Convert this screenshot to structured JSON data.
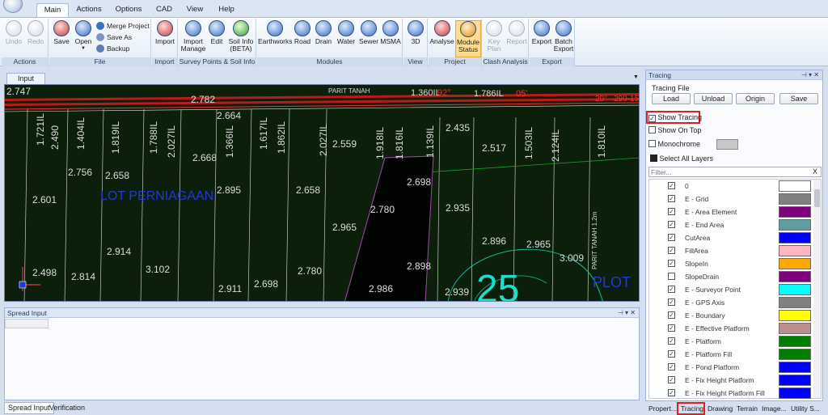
{
  "tabs": [
    "Main",
    "Actions",
    "Options",
    "CAD",
    "View",
    "Help"
  ],
  "ribbon": {
    "actions": {
      "label": "Actions",
      "undo": "Undo",
      "redo": "Redo"
    },
    "file": {
      "label": "File",
      "save": "Save",
      "open": "Open",
      "merge": "Merge Project",
      "save_as": "Save As",
      "backup": "Backup"
    },
    "import": {
      "label": "Import",
      "import": "Import"
    },
    "survey": {
      "label": "Survey Points & Soil Info",
      "import_manage": "Import Manage",
      "edit": "Edit",
      "soil_info": "Soil Info (BETA)"
    },
    "modules": {
      "label": "Modules",
      "items": [
        "Earthworks",
        "Road",
        "Drain",
        "Water",
        "Sewer",
        "MSMA"
      ]
    },
    "view": {
      "label": "View",
      "3d": "3D"
    },
    "project": {
      "label": "Project",
      "analyse": "Analyse",
      "module_status": "Module Status"
    },
    "clash": {
      "label": "Clash Analysis",
      "key_plan": "Key Plan",
      "report": "Report"
    },
    "export": {
      "label": "Export",
      "export": "Export",
      "batch_export": "Batch Export"
    }
  },
  "input_tab": "Input",
  "spread_input": {
    "title": "Spread Input"
  },
  "bottom_tabs": [
    "Spread Input",
    "Verification"
  ],
  "tracing": {
    "title": "Tracing",
    "file_label": "Tracing File",
    "buttons": [
      "Load",
      "Unload",
      "Origin",
      "Save"
    ],
    "show_tracing": "Show Tracing",
    "show_on_top": "Show On Top",
    "monochrome": "Monochrome",
    "select_all": "Select All Layers",
    "filter_placeholder": "Filter...",
    "layers": [
      {
        "name": "0",
        "checked": true,
        "color": "#ffffff"
      },
      {
        "name": "E - Grid",
        "checked": true,
        "color": "#808080"
      },
      {
        "name": "E - Area Element",
        "checked": true,
        "color": "#800080"
      },
      {
        "name": "E - End Area",
        "checked": true,
        "color": "#5f9ea0"
      },
      {
        "name": "CutArea",
        "checked": true,
        "color": "#0000ff"
      },
      {
        "name": "FillArea",
        "checked": true,
        "color": "#ffb6c1"
      },
      {
        "name": "SlopeIn",
        "checked": true,
        "color": "#ffa500"
      },
      {
        "name": "SlopeDrain",
        "checked": false,
        "color": "#800080"
      },
      {
        "name": "E - Surveyor Point",
        "checked": true,
        "color": "#00ffff"
      },
      {
        "name": "E - GPS Axis",
        "checked": true,
        "color": "#808080"
      },
      {
        "name": "E - Boundary",
        "checked": true,
        "color": "#ffff00"
      },
      {
        "name": "E - Effective Platform",
        "checked": true,
        "color": "#bc8f8f"
      },
      {
        "name": "E - Platform",
        "checked": true,
        "color": "#008000"
      },
      {
        "name": "E - Platform Fill",
        "checked": true,
        "color": "#008000"
      },
      {
        "name": "E - Pond Platform",
        "checked": true,
        "color": "#0000ff"
      },
      {
        "name": "E - Fix Height Platform",
        "checked": true,
        "color": "#0000ff"
      },
      {
        "name": "E - Fix Height Platform Fill",
        "checked": true,
        "color": "#0000ff"
      }
    ]
  },
  "right_tabs": [
    "Propert...",
    "Tracing",
    "Drawing",
    "Terrain",
    "Image...",
    "Utility S..."
  ],
  "drawing": {
    "labels": [
      "2.747",
      "2.782",
      "PARIT TANAH",
      "1.360IL",
      "92°",
      "1.786IL",
      "05'",
      "20°",
      "290-15",
      "2.664",
      "1.721IL",
      "1.404IL",
      "1.819IL",
      "1.788IL",
      "2.027IL",
      "2.668",
      "1.366IL",
      "1.617IL",
      "1.862IL",
      "2.027IL",
      "2.559",
      "1.918IL",
      "1.816IL",
      "1.139IL",
      "2.435",
      "2.517",
      "1.503IL",
      "2.124IL",
      "1.810IL",
      "2.490",
      "2.756",
      "2.658",
      "2.698",
      "2.601",
      "LOT PERNIAGAAN",
      "2.895",
      "2.658",
      "2.780",
      "2.935",
      "2.965",
      "2.914",
      "2.896",
      "2.965",
      "3.102",
      "3.009",
      "2.498",
      "2.814",
      "2.911",
      "2.698",
      "2.780",
      "2.986",
      "2.898",
      "2.939",
      "25",
      "PLOT",
      "PARIT TANAH 1.2m"
    ]
  }
}
